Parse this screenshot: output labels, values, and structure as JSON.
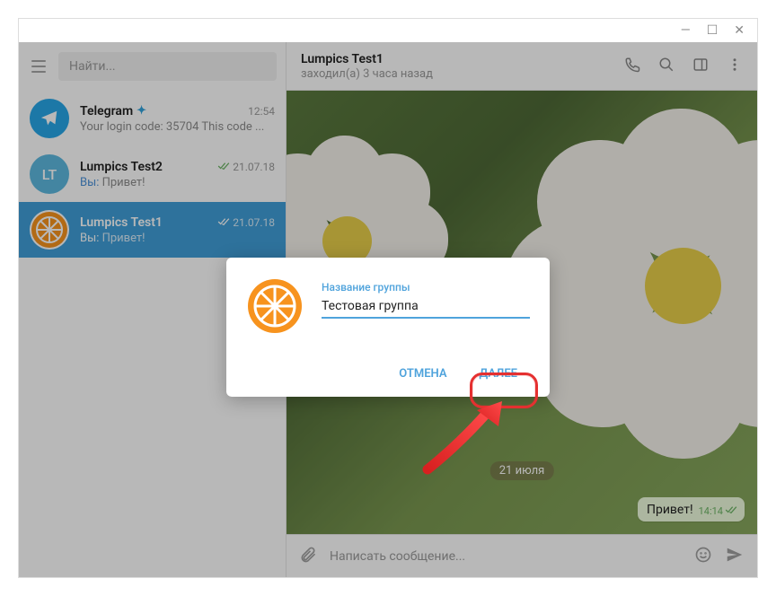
{
  "titlebar": {
    "min": "—",
    "max": "☐",
    "close": "✕"
  },
  "search": {
    "placeholder": "Найти..."
  },
  "chats": {
    "telegram": {
      "name": "Telegram",
      "time": "12:54",
      "preview": "Your login code: 35704  This code ..."
    },
    "test2": {
      "name": "Lumpics Test2",
      "time": "21.07.18",
      "you": "Вы:",
      "preview": "Привет!",
      "initials": "LT"
    },
    "test1": {
      "name": "Lumpics Test1",
      "time": "21.07.18",
      "you": "Вы:",
      "preview": "Привет!"
    }
  },
  "header": {
    "name": "Lumpics Test1",
    "status": "заходил(а) 3 часа назад"
  },
  "dateBadge": "21 июля",
  "message": {
    "text": "Привет!",
    "time": "14:14"
  },
  "composer": {
    "placeholder": "Написать сообщение..."
  },
  "dialog": {
    "label": "Название группы",
    "value": "Тестовая группа",
    "cancel": "ОТМЕНА",
    "next": "ДАЛЕЕ"
  }
}
